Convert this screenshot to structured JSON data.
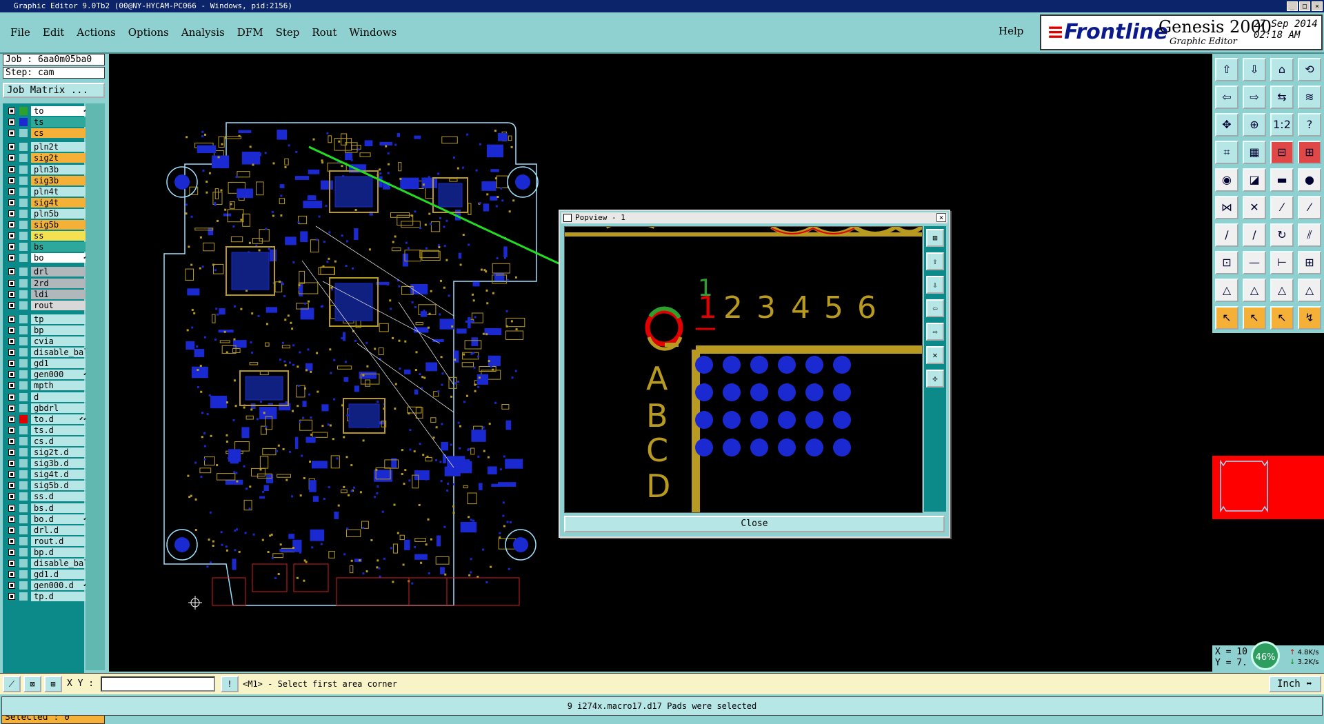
{
  "window": {
    "title": "Graphic Editor 9.0Tb2 (00@NY-HYCAM-PC066 - Windows, pid:2156)",
    "controls": [
      "_",
      "□",
      "×"
    ]
  },
  "menu": {
    "items": [
      "File",
      "Edit",
      "Actions",
      "Options",
      "Analysis",
      "DFM",
      "Step",
      "Rout",
      "Windows"
    ],
    "help": "Help"
  },
  "brand": {
    "logo": "Frontline",
    "product": "Genesis 2000",
    "subtitle": "Graphic Editor",
    "date": "27 Sep 2014",
    "time": "02:18 AM"
  },
  "job": {
    "job_label": "Job : 6aa0m05ba0",
    "step_label": "Step: cam",
    "matrix_button": "Job Matrix ..."
  },
  "layers": [
    {
      "name": "to",
      "color": "#ffffff",
      "swatch": "#2ea02e",
      "mark": "⬋"
    },
    {
      "name": "ts",
      "color": "#2ea89a",
      "swatch": "#1a2ad0",
      "mark": ""
    },
    {
      "name": "cs",
      "color": "#f5b038",
      "swatch": "",
      "mark": ""
    },
    {
      "name": "pln2t",
      "color": "#b6e6e6",
      "swatch": "",
      "mark": ""
    },
    {
      "name": "sig2t",
      "color": "#f5b038",
      "swatch": "",
      "mark": ""
    },
    {
      "name": "pln3b",
      "color": "#b6e6e6",
      "swatch": "",
      "mark": ""
    },
    {
      "name": "sig3b",
      "color": "#f5b038",
      "swatch": "",
      "mark": ""
    },
    {
      "name": "pln4t",
      "color": "#b6e6e6",
      "swatch": "",
      "mark": ""
    },
    {
      "name": "sig4t",
      "color": "#f5b038",
      "swatch": "",
      "mark": ""
    },
    {
      "name": "pln5b",
      "color": "#b6e6e6",
      "swatch": "",
      "mark": ""
    },
    {
      "name": "sig5b",
      "color": "#f5b038",
      "swatch": "",
      "mark": ""
    },
    {
      "name": "ss",
      "color": "#f5e050",
      "swatch": "",
      "mark": ""
    },
    {
      "name": "bs",
      "color": "#2ea89a",
      "swatch": "",
      "mark": ""
    },
    {
      "name": "bo",
      "color": "#ffffff",
      "swatch": "",
      "mark": "⬋"
    },
    {
      "name": "drl",
      "color": "#b0b8bc",
      "swatch": "",
      "mark": ""
    },
    {
      "name": "2rd",
      "color": "#b0b8bc",
      "swatch": "",
      "mark": ""
    },
    {
      "name": "ldi",
      "color": "#b0b8bc",
      "swatch": "",
      "mark": ""
    },
    {
      "name": "rout",
      "color": "#d8d8d8",
      "swatch": "",
      "mark": ""
    },
    {
      "name": "tp",
      "color": "#b6e6e6",
      "swatch": "",
      "mark": ""
    },
    {
      "name": "bp",
      "color": "#b6e6e6",
      "swatch": "",
      "mark": ""
    },
    {
      "name": "cvia",
      "color": "#b6e6e6",
      "swatch": "",
      "mark": ""
    },
    {
      "name": "disable_bal",
      "color": "#b6e6e6",
      "swatch": "",
      "mark": ""
    },
    {
      "name": "gd1",
      "color": "#b6e6e6",
      "swatch": "",
      "mark": ""
    },
    {
      "name": "gen000",
      "color": "#b6e6e6",
      "swatch": "",
      "mark": "⬋"
    },
    {
      "name": "mpth",
      "color": "#b6e6e6",
      "swatch": "",
      "mark": ""
    },
    {
      "name": "d",
      "color": "#b6e6e6",
      "swatch": "",
      "mark": ""
    },
    {
      "name": "gbdrl",
      "color": "#b6e6e6",
      "swatch": "",
      "mark": ""
    },
    {
      "name": "to.d",
      "color": "#b6e6e6",
      "swatch": "#e00000",
      "mark": "⬋⬋"
    },
    {
      "name": "ts.d",
      "color": "#b6e6e6",
      "swatch": "",
      "mark": ""
    },
    {
      "name": "cs.d",
      "color": "#b6e6e6",
      "swatch": "",
      "mark": ""
    },
    {
      "name": "sig2t.d",
      "color": "#b6e6e6",
      "swatch": "",
      "mark": ""
    },
    {
      "name": "sig3b.d",
      "color": "#b6e6e6",
      "swatch": "",
      "mark": ""
    },
    {
      "name": "sig4t.d",
      "color": "#b6e6e6",
      "swatch": "",
      "mark": ""
    },
    {
      "name": "sig5b.d",
      "color": "#b6e6e6",
      "swatch": "",
      "mark": ""
    },
    {
      "name": "ss.d",
      "color": "#b6e6e6",
      "swatch": "",
      "mark": ""
    },
    {
      "name": "bs.d",
      "color": "#b6e6e6",
      "swatch": "",
      "mark": ""
    },
    {
      "name": "bo.d",
      "color": "#b6e6e6",
      "swatch": "",
      "mark": "⬋"
    },
    {
      "name": "drl.d",
      "color": "#b6e6e6",
      "swatch": "",
      "mark": ""
    },
    {
      "name": "rout.d",
      "color": "#b6e6e6",
      "swatch": "",
      "mark": ""
    },
    {
      "name": "bp.d",
      "color": "#b6e6e6",
      "swatch": "",
      "mark": ""
    },
    {
      "name": "disable_bal",
      "color": "#b6e6e6",
      "swatch": "",
      "mark": ""
    },
    {
      "name": "gd1.d",
      "color": "#b6e6e6",
      "swatch": "",
      "mark": ""
    },
    {
      "name": "gen000.d",
      "color": "#b6e6e6",
      "swatch": "",
      "mark": "⬋"
    },
    {
      "name": "tp.d",
      "color": "#b6e6e6",
      "swatch": "",
      "mark": ""
    }
  ],
  "selected_label": "Selected : 0",
  "popview": {
    "title": "Popview - 1",
    "close_label": "Close",
    "numbers": [
      "1",
      "1",
      "2",
      "3",
      "4",
      "5",
      "6"
    ],
    "letters": [
      "A",
      "B",
      "C",
      "D"
    ]
  },
  "commandbar": {
    "xy_label": "X Y :",
    "prompt": "<M1> - Select first area corner",
    "unit": "Inch"
  },
  "coords": {
    "x": "X = 10",
    "y": "Y = 7.",
    "zoom_badge": "46%",
    "up_rate": "4.8K/s",
    "down_rate": "3.2K/s"
  },
  "status_message": "9 i274x.macro17.d17 Pads were selected",
  "colors": {
    "pcb_pad_blue": "#1a2ad0",
    "pcb_trace_gold": "#b89a20",
    "highlight_red": "#e00000",
    "arrow_green": "#22dd22",
    "panel_teal": "#8fd0d0"
  },
  "icons": {
    "toolbar": [
      "layer-up-icon",
      "layer-down-icon",
      "home-icon",
      "redraw-icon",
      "left-icon",
      "right-icon",
      "fit-icon",
      "ratio-icon",
      "zoom-in-icon",
      "zoom-out-icon",
      "one-to-one-icon",
      "help-icon"
    ]
  }
}
